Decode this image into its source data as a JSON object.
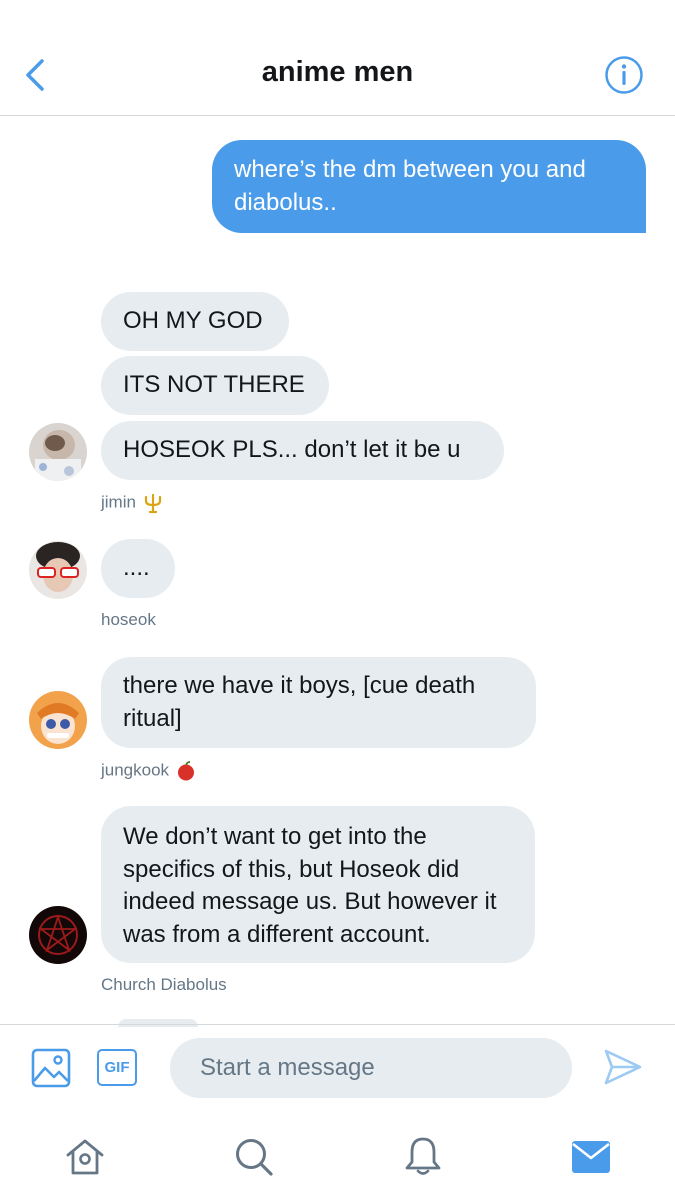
{
  "header": {
    "title": "anime men"
  },
  "messages": {
    "outgoing": "where’s the dm between you and diabolus..",
    "jimin": [
      "OH MY GOD",
      "ITS NOT THERE",
      "HOSEOK PLS... don’t let it be u"
    ],
    "hoseok": [
      "...."
    ],
    "jungkook": [
      "there we have it boys, [cue death ritual]"
    ],
    "church": [
      "We don’t want to get into the specifics of this, but Hoseok did indeed message us. But however it was from a different account."
    ]
  },
  "senders": {
    "jimin": "jimin",
    "hoseok": "hoseok",
    "jungkook": "jungkook",
    "church": "Church Diabolus"
  },
  "sender_emoji": {
    "jimin": "trident-icon",
    "jungkook": "apple-icon"
  },
  "composer": {
    "placeholder": "Start a message",
    "gif_label": "GIF"
  },
  "colors": {
    "accent": "#4a9cea",
    "incoming_bubble": "#e6ecf0",
    "meta_text": "#657786"
  }
}
